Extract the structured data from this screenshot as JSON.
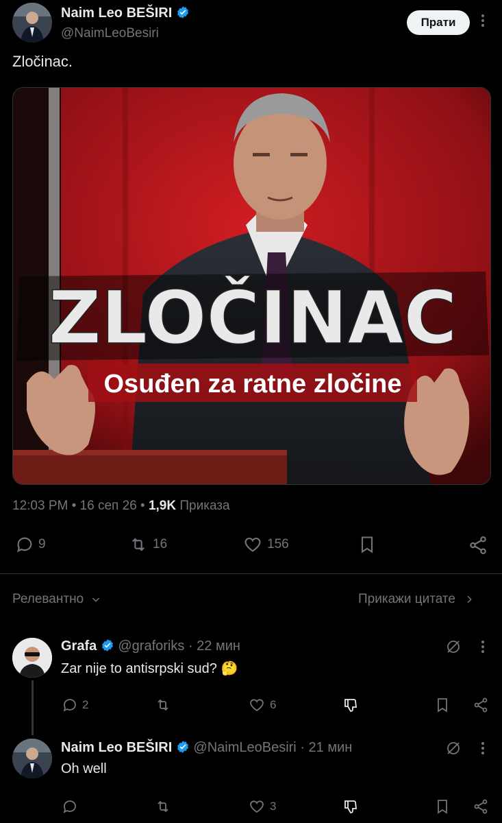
{
  "main_tweet": {
    "author_name": "Naim Leo BEŠIRI",
    "author_handle": "@NaimLeoBesiri",
    "follow_label": "Прати",
    "text": "Zločinac.",
    "image": {
      "headline": "ZLOČINAC",
      "subline": "Osuđen za ratne zločine"
    },
    "time": "12:03 PM",
    "date": "16 сеп 26",
    "views_count": "1,9K",
    "views_label": "Приказа",
    "replies": "9",
    "reposts": "16",
    "likes": "156"
  },
  "replies_header": {
    "sort_label": "Релевантно",
    "quotes_label": "Прикажи цитате"
  },
  "replies": [
    {
      "author_name": "Grafa",
      "author_handle": "@graforiks",
      "time": "22 мин",
      "text": "Zar nije to antisrpski sud? 🤔",
      "replies": "2",
      "reposts": "",
      "likes": "6"
    },
    {
      "author_name": "Naim Leo BEŠIRI",
      "author_handle": "@NaimLeoBesiri",
      "time": "21 мин",
      "text": "Oh well",
      "replies": "",
      "reposts": "",
      "likes": "3"
    }
  ],
  "icons": [
    "verified-badge-icon",
    "more-icon",
    "reply-icon",
    "repost-icon",
    "like-icon",
    "bookmark-icon",
    "share-icon",
    "chevron-down-icon",
    "chevron-right-icon",
    "grok-icon",
    "downvote-icon"
  ],
  "colors": {
    "background": "#000000",
    "text": "#e7e9ea",
    "secondary": "#71767b",
    "verified": "#1d9bf0",
    "divider": "#2f3336",
    "image_red": "#b3151b"
  }
}
